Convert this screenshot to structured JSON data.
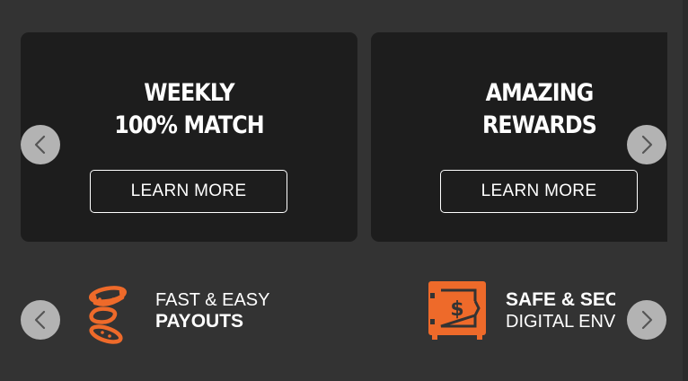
{
  "colors": {
    "background": "#333333",
    "card": "#1d1d1d",
    "accent": "#ee6a2a",
    "arrow_bg": "#b3b3b3",
    "arrow_fg": "#555555",
    "text": "#ffffff"
  },
  "promos": [
    {
      "title_line1": "WEEKLY",
      "title_line2": "100% MATCH",
      "button_label": "LEARN MORE"
    },
    {
      "title_line1": "AMAZING",
      "title_line2": "REWARDS",
      "button_label": "LEARN MORE"
    }
  ],
  "features": [
    {
      "icon": "coins-icon",
      "line1": "FAST & EASY",
      "line2": "PAYOUTS"
    },
    {
      "icon": "safe-icon",
      "line1": "SAFE & SECURE",
      "line2": "DIGITAL ENVIRONMENT"
    }
  ],
  "arrows": {
    "prev_icon": "chevron-left-icon",
    "next_icon": "chevron-right-icon"
  }
}
